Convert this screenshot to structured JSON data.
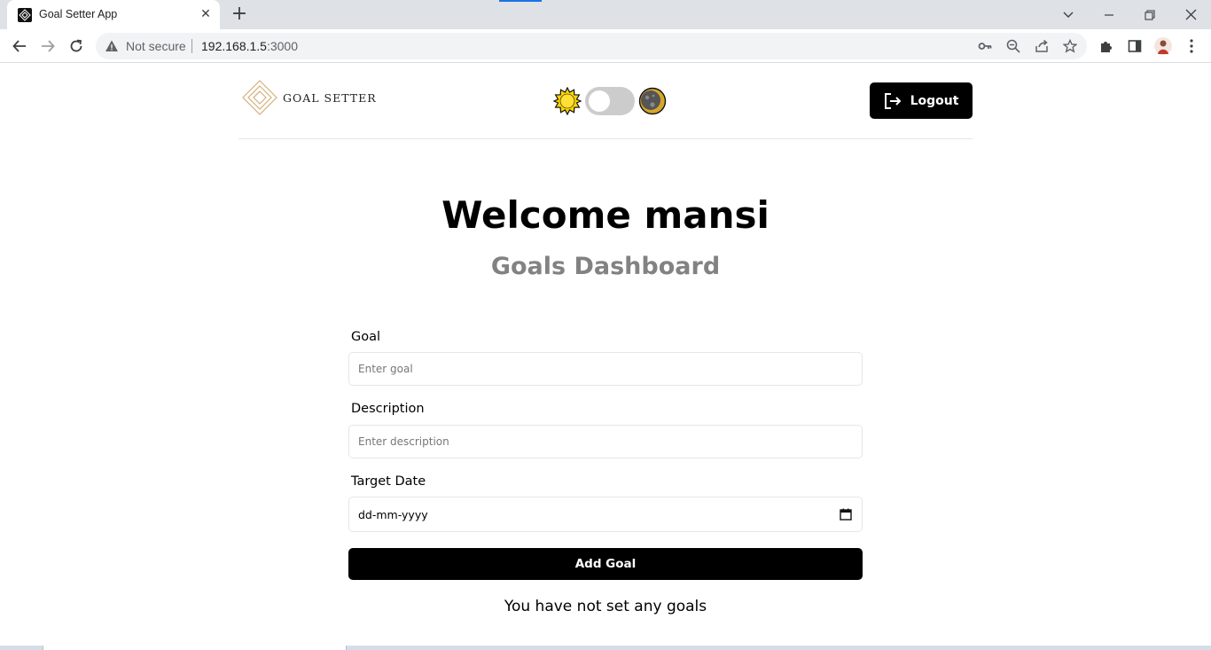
{
  "browser": {
    "tab_title": "Goal Setter App",
    "security_label": "Not secure",
    "url_host": "192.168.1.5",
    "url_port": ":3000"
  },
  "header": {
    "brand": "GOAL SETTER",
    "logout_label": "Logout",
    "theme_toggle_on": false
  },
  "main": {
    "welcome": "Welcome mansi",
    "subtitle": "Goals Dashboard",
    "form": {
      "goal_label": "Goal",
      "goal_placeholder": "Enter goal",
      "description_label": "Description",
      "description_placeholder": "Enter description",
      "date_label": "Target Date",
      "date_placeholder": "dd-mm-yyyy",
      "submit_label": "Add Goal"
    },
    "empty_message": "You have not set any goals"
  },
  "colors": {
    "primary": "#000000",
    "subtitle": "#828282",
    "logo_gold": "#d4b07a",
    "sun": "#ffd400",
    "moon": "#d6a62a"
  }
}
